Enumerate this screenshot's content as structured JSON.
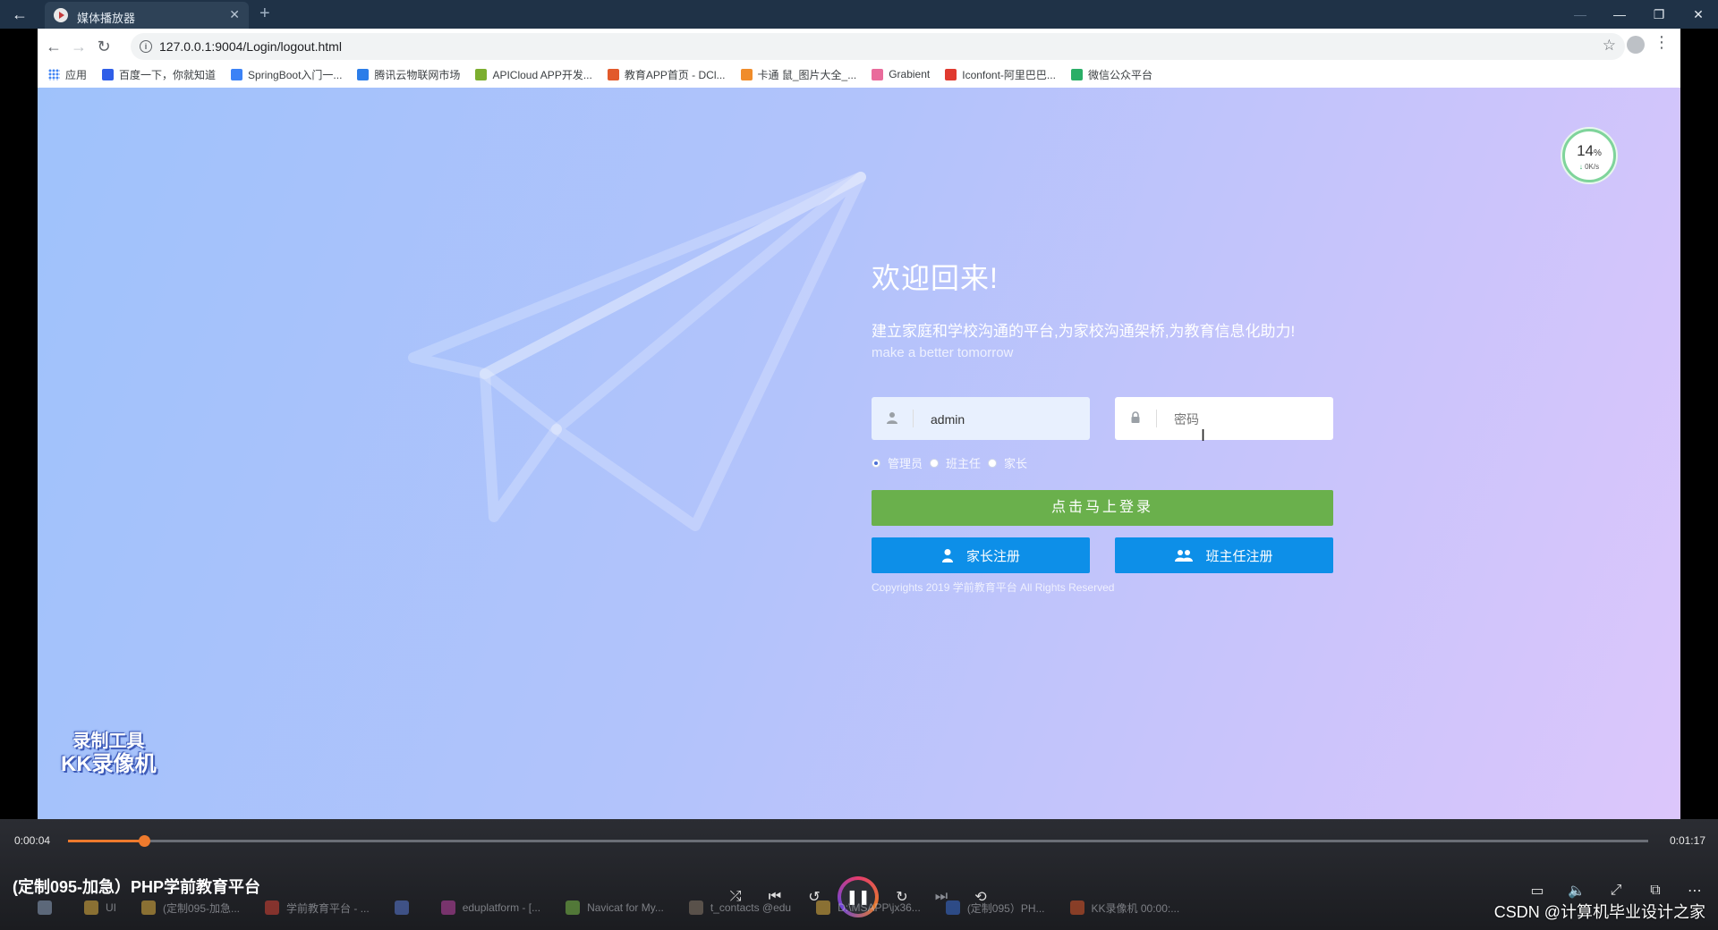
{
  "player": {
    "tab_title": "媒体播放器",
    "back_icon": "back-arrow-icon",
    "video_title": "(定制095-加急）PHP学前教育平台",
    "time_current": "0:00:04",
    "time_total": "0:01:17",
    "progress": 0.048,
    "accent_color": "#ee7a2d",
    "watermark": [
      "录制工具",
      "KK录像机"
    ],
    "credit": "CSDN @计算机毕业设计之家"
  },
  "browser": {
    "url": "127.0.0.1:9004/Login/logout.html",
    "bookmarks": [
      {
        "label": "应用",
        "icon": "apps-grid-icon",
        "color": "#4285f4"
      },
      {
        "label": "百度一下，你就知道",
        "icon": "baidu-paw-icon",
        "color": "#2f5ee8"
      },
      {
        "label": "SpringBoot入门一...",
        "icon": "pen-icon",
        "color": "#3b82f6"
      },
      {
        "label": "腾讯云物联网市场",
        "icon": "cloud-icon",
        "color": "#2b7de9"
      },
      {
        "label": "APICloud APP开发...",
        "icon": "apicloud-icon",
        "color": "#7cae2f"
      },
      {
        "label": "教育APP首页 - DCl...",
        "icon": "tag-icon",
        "color": "#e25a2b"
      },
      {
        "label": "卡通 鼠_图片大全_...",
        "icon": "a-logo-icon",
        "color": "#f08c2a"
      },
      {
        "label": "Grabient",
        "icon": "gradient-circle-icon",
        "color": "#e96b9b"
      },
      {
        "label": "Iconfont-阿里巴巴...",
        "icon": "iconfont-icon",
        "color": "#e03a2f"
      },
      {
        "label": "微信公众平台",
        "icon": "wechat-icon",
        "color": "#2aae67"
      }
    ]
  },
  "login": {
    "welcome": "欢迎回来!",
    "slogan": "建立家庭和学校沟通的平台,为家校沟通架桥,为教育信息化助力!",
    "slogan_en": "make a better tomorrow",
    "username_value": "admin",
    "password_placeholder": "密码",
    "roles": [
      {
        "label": "管理员",
        "selected": true
      },
      {
        "label": "班主任",
        "selected": false
      },
      {
        "label": "家长",
        "selected": false
      }
    ],
    "login_button": "点击马上登录",
    "register_parent": "家长注册",
    "register_teacher": "班主任注册",
    "copyright": "Copyrights 2019 学前教育平台 All Rights Reserved",
    "login_color": "#6ab04c",
    "register_color": "#0d8fe8"
  },
  "net_widget": {
    "percent": "14",
    "percent_sign": "%",
    "speed": "0K/s"
  },
  "taskbar": [
    {
      "label": "UI",
      "color": "#e3b341"
    },
    {
      "label": "(定制095-加急...",
      "color": "#e3b341"
    },
    {
      "label": "学前教育平台 - ...",
      "color": "#d94436"
    },
    {
      "label": "",
      "color": "#5a7bd6"
    },
    {
      "label": "eduplatform - [...",
      "color": "#c245a8"
    },
    {
      "label": "Navicat for My...",
      "color": "#7dc04a"
    },
    {
      "label": "t_contacts @edu",
      "color": "#8a7a6a"
    },
    {
      "label": "D:\\MSAPP\\jx36...",
      "color": "#e3b341"
    },
    {
      "label": "(定制095）PH...",
      "color": "#3b6fd6"
    },
    {
      "label": "KK录像机 00:00:...",
      "color": "#e0582b"
    }
  ]
}
